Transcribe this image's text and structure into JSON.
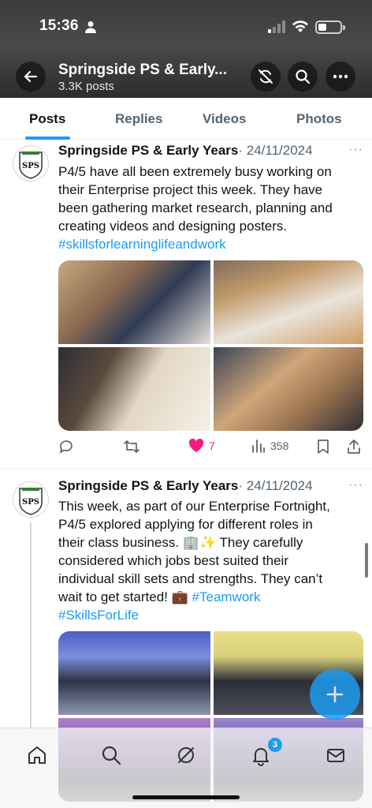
{
  "status_bar": {
    "time": "15:36"
  },
  "header": {
    "title": "Springside PS & Early...",
    "post_count": "3.3K posts"
  },
  "tabs": [
    {
      "label": "Posts",
      "active": true
    },
    {
      "label": "Replies",
      "active": false
    },
    {
      "label": "Videos",
      "active": false
    },
    {
      "label": "Photos",
      "active": false
    }
  ],
  "tweets": [
    {
      "author": "Springside PS & Early Years",
      "date": "· 24/11/2024",
      "more": "···",
      "avatar_text": "SPS",
      "lines": [
        "P4/5 have all been extremely busy working on",
        "their Enterprise project this week. They have",
        "been gathering market research, planning and",
        "creating videos and designing posters."
      ],
      "hashtags": "#skillsforlearninglifeandwork",
      "actions": {
        "replies": "",
        "retweets": "",
        "likes": "7",
        "views": "358"
      }
    },
    {
      "author": "Springside PS & Early Years",
      "date": "· 24/11/2024",
      "more": "···",
      "avatar_text": "SPS",
      "lines": [
        "This week, as part of our Enterprise Fortnight,",
        "P4/5 explored applying for different roles in",
        "their class business. 🏢✨ They carefully",
        "considered which jobs best suited their",
        "individual skill sets and strengths. They can’t",
        "wait to get started! 💼 "
      ],
      "inline_hashtag": "#Teamwork",
      "hashtags": "#SkillsForLife"
    }
  ],
  "bottom_nav": {
    "notification_count": "3"
  },
  "colors": {
    "accent": "#1d9bf0",
    "like": "#f91880",
    "muted": "#536471"
  },
  "icons": [
    "back-arrow-icon",
    "sync-off-icon",
    "search-icon",
    "more-icon",
    "reply-icon",
    "retweet-icon",
    "heart-icon",
    "views-icon",
    "bookmark-icon",
    "share-icon",
    "home-icon",
    "grok-icon",
    "bell-icon",
    "mail-icon",
    "plus-icon"
  ]
}
